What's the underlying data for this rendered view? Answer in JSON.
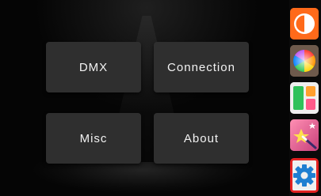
{
  "menu": {
    "dmx": "DMX",
    "connection": "Connection",
    "misc": "Misc",
    "about": "About"
  },
  "sidebar": {
    "icons": [
      {
        "name": "contrast-icon",
        "color": "#ff6a1a"
      },
      {
        "name": "color-wheel-icon",
        "color": "#8a6e5a"
      },
      {
        "name": "layout-icon",
        "color": "#efefef"
      },
      {
        "name": "magic-wand-icon",
        "color": "#e85d8e"
      },
      {
        "name": "gear-icon",
        "color": "#1f7fd1",
        "selected": true,
        "selection_color": "#e32121"
      }
    ]
  }
}
